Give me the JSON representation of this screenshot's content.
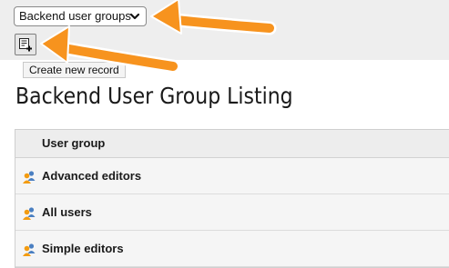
{
  "toolbar": {
    "select_value": "Backend user groups",
    "new_record_tooltip": "Create new record"
  },
  "page": {
    "title": "Backend User Group Listing"
  },
  "table": {
    "header": "User group",
    "rows": [
      {
        "label": "Advanced editors",
        "icon": "user-group-icon"
      },
      {
        "label": "All users",
        "icon": "user-group-icon"
      },
      {
        "label": "Simple editors",
        "icon": "user-group-icon"
      }
    ]
  },
  "colors": {
    "arrow": "#f7931e",
    "topbar": "#eeeeee",
    "group_icon_orange": "#f39c12",
    "group_icon_blue": "#4a7fc1"
  },
  "icons": {
    "select": "chevron-down-icon",
    "new_record": "new-record-icon"
  }
}
